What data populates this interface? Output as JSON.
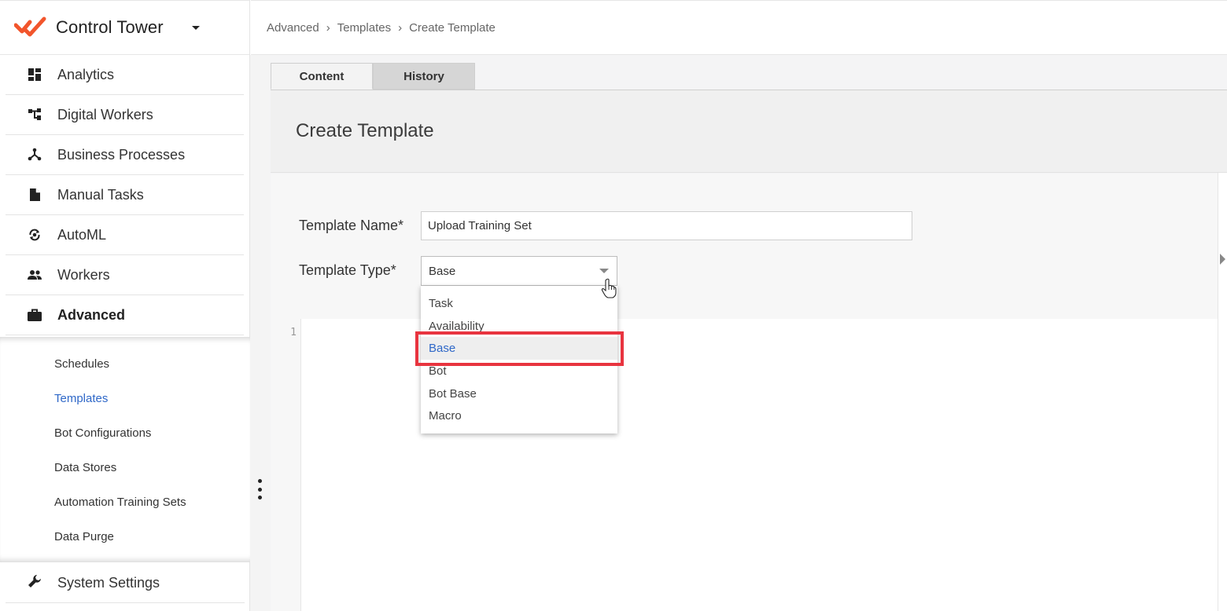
{
  "app": {
    "title": "Control Tower"
  },
  "sidebar": {
    "items": [
      {
        "label": "Analytics",
        "icon": "dashboard-icon"
      },
      {
        "label": "Digital Workers",
        "icon": "hierarchy-icon"
      },
      {
        "label": "Business Processes",
        "icon": "process-icon"
      },
      {
        "label": "Manual Tasks",
        "icon": "document-icon"
      },
      {
        "label": "AutoML",
        "icon": "automl-icon"
      },
      {
        "label": "Workers",
        "icon": "people-icon"
      },
      {
        "label": "Advanced",
        "icon": "briefcase-icon"
      }
    ],
    "sub_items": [
      {
        "label": "Schedules"
      },
      {
        "label": "Templates"
      },
      {
        "label": "Bot Configurations"
      },
      {
        "label": "Data Stores"
      },
      {
        "label": "Automation Training Sets"
      },
      {
        "label": "Data Purge"
      }
    ],
    "settings_label": "System Settings"
  },
  "breadcrumb": [
    "Advanced",
    "Templates",
    "Create Template"
  ],
  "tabs": [
    {
      "label": "Content"
    },
    {
      "label": "History"
    }
  ],
  "page": {
    "title": "Create Template",
    "name_label": "Template Name*",
    "name_value": "Upload Training Set",
    "type_label": "Template Type*",
    "type_value": "Base"
  },
  "dropdown": {
    "options": [
      "Task",
      "Availability",
      "Base",
      "Bot",
      "Bot Base",
      "Macro"
    ]
  },
  "editor": {
    "line_number": "1"
  },
  "colors": {
    "accent": "#2f68c8",
    "brand": "#f2552c",
    "highlight": "#e8343f"
  }
}
